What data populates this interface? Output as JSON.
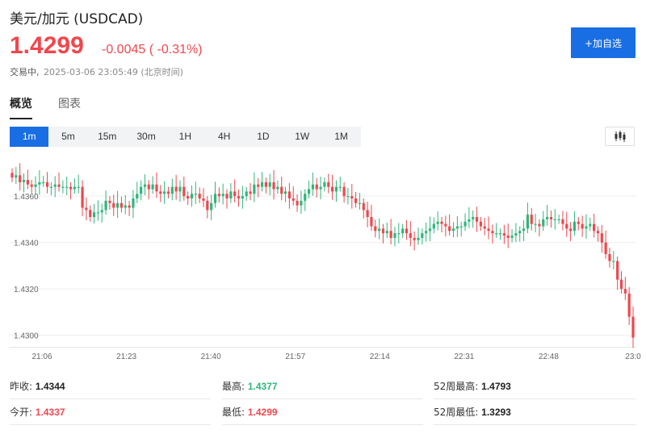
{
  "header": {
    "title": "美元/加元 (USDCAD)",
    "price": "1.4299",
    "change": "-0.0045",
    "change_pct": "( -0.31%)",
    "status": "交易中,",
    "timestamp": "2025-03-06 23:05:49",
    "timezone": "(北京时间)",
    "watch_button": "+加自选"
  },
  "tabs": [
    {
      "label": "概览",
      "active": true
    },
    {
      "label": "图表",
      "active": false
    }
  ],
  "periods": [
    {
      "label": "1m",
      "active": true
    },
    {
      "label": "5m",
      "active": false
    },
    {
      "label": "15m",
      "active": false
    },
    {
      "label": "30m",
      "active": false
    },
    {
      "label": "1H",
      "active": false
    },
    {
      "label": "4H",
      "active": false
    },
    {
      "label": "1D",
      "active": false
    },
    {
      "label": "1W",
      "active": false
    },
    {
      "label": "1M",
      "active": false
    }
  ],
  "chart_type_icon": "candlestick-icon",
  "colors": {
    "up": "#2fb67c",
    "down": "#f0474d",
    "accent": "#1a6ee3"
  },
  "chart_data": {
    "type": "candlestick",
    "y_ticks": [
      "1.4360",
      "1.4340",
      "1.4320",
      "1.4300"
    ],
    "ylim": [
      1.4295,
      1.4375
    ],
    "x_ticks": [
      "21:06",
      "21:23",
      "21:40",
      "21:57",
      "22:14",
      "22:31",
      "22:48",
      "23:0"
    ],
    "grid": true,
    "closes": [
      1.4368,
      1.4369,
      1.4366,
      1.4367,
      1.4365,
      1.4364,
      1.4365,
      1.4366,
      1.4366,
      1.4364,
      1.4364,
      1.4365,
      1.4364,
      1.4364,
      1.4364,
      1.4363,
      1.4364,
      1.4364,
      1.4355,
      1.4354,
      1.4351,
      1.4353,
      1.4353,
      1.4354,
      1.4358,
      1.4357,
      1.4355,
      1.4357,
      1.4355,
      1.4356,
      1.4355,
      1.4359,
      1.4361,
      1.4364,
      1.4365,
      1.4363,
      1.4365,
      1.4362,
      1.4361,
      1.4362,
      1.4361,
      1.4364,
      1.4362,
      1.4364,
      1.436,
      1.4359,
      1.4361,
      1.4361,
      1.4359,
      1.4358,
      1.4354,
      1.4357,
      1.4361,
      1.436,
      1.4361,
      1.4359,
      1.4362,
      1.436,
      1.4359,
      1.436,
      1.4362,
      1.4361,
      1.4365,
      1.4364,
      1.4366,
      1.4364,
      1.4366,
      1.4363,
      1.4364,
      1.4361,
      1.4362,
      1.4359,
      1.4358,
      1.4356,
      1.4358,
      1.4361,
      1.4363,
      1.4365,
      1.4363,
      1.4364,
      1.4366,
      1.4364,
      1.4362,
      1.4364,
      1.4364,
      1.436,
      1.436,
      1.4359,
      1.4357,
      1.4357,
      1.4354,
      1.4351,
      1.4347,
      1.4345,
      1.4346,
      1.4344,
      1.4345,
      1.4342,
      1.4344,
      1.4344,
      1.4346,
      1.4344,
      1.4342,
      1.4341,
      1.4342,
      1.4344,
      1.4345,
      1.4346,
      1.4348,
      1.4349,
      1.4348,
      1.4347,
      1.4345,
      1.4346,
      1.4347,
      1.4347,
      1.4349,
      1.435,
      1.4351,
      1.4349,
      1.4347,
      1.4346,
      1.4345,
      1.4344,
      1.4344,
      1.4344,
      1.4343,
      1.4342,
      1.4343,
      1.4344,
      1.4345,
      1.4346,
      1.4352,
      1.4348,
      1.4348,
      1.4347,
      1.435,
      1.4351,
      1.435,
      1.435,
      1.435,
      1.4348,
      1.4346,
      1.4345,
      1.4349,
      1.4348,
      1.4346,
      1.4347,
      1.4348,
      1.4345,
      1.4344,
      1.434,
      1.4335,
      1.4332,
      1.4332,
      1.4324,
      1.432,
      1.4318,
      1.4308,
      1.4299
    ]
  },
  "stats": [
    [
      {
        "label": "昨收:",
        "value": "1.4344",
        "color": "dark"
      },
      {
        "label": "最高:",
        "value": "1.4377",
        "color": "green"
      },
      {
        "label": "52周最高:",
        "value": "1.4793",
        "color": "dark"
      }
    ],
    [
      {
        "label": "今开:",
        "value": "1.4337",
        "color": "red"
      },
      {
        "label": "最低:",
        "value": "1.4299",
        "color": "red"
      },
      {
        "label": "52周最低:",
        "value": "1.3293",
        "color": "dark"
      }
    ]
  ]
}
